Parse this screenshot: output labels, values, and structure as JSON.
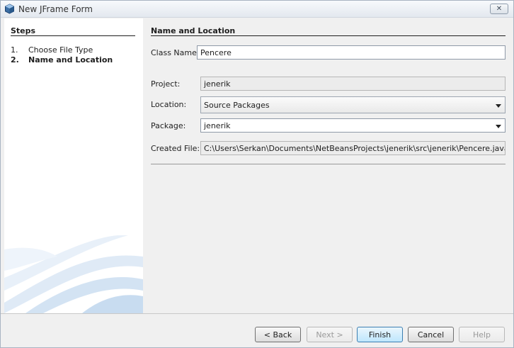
{
  "window": {
    "title": "New JFrame Form",
    "close_glyph": "✕",
    "icon": "netbeans-cube-icon"
  },
  "steps": {
    "title": "Steps",
    "items": [
      {
        "num": "1.",
        "label": "Choose File Type"
      },
      {
        "num": "2.",
        "label": "Name and Location"
      }
    ]
  },
  "form": {
    "title": "Name and Location",
    "class_name": {
      "label": "Class Name:",
      "value": "Pencere"
    },
    "project": {
      "label": "Project:",
      "value": "jenerik"
    },
    "location": {
      "label": "Location:",
      "value": "Source Packages"
    },
    "package": {
      "label": "Package:",
      "value": "jenerik"
    },
    "created_file": {
      "label": "Created File:",
      "value": "C:\\Users\\Serkan\\Documents\\NetBeansProjects\\jenerik\\src\\jenerik\\Pencere.java"
    }
  },
  "buttons": {
    "back": "< Back",
    "next": "Next >",
    "finish": "Finish",
    "cancel": "Cancel",
    "help": "Help"
  }
}
